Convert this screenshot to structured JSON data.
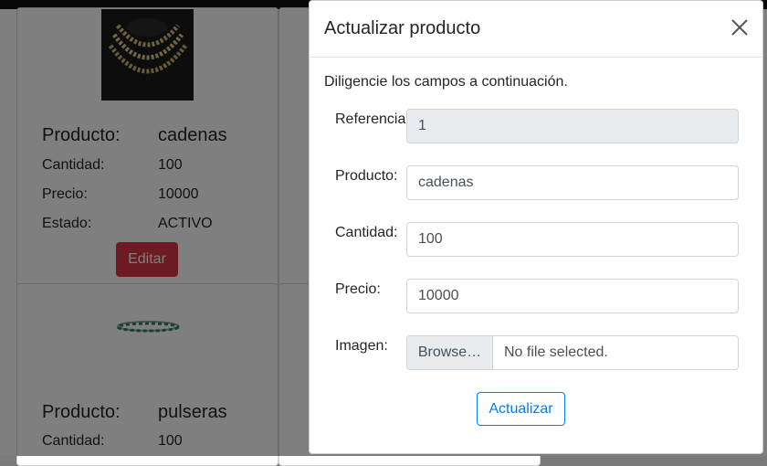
{
  "colors": {
    "danger": "#dc3545",
    "primary": "#007bff"
  },
  "products": [
    {
      "image_icon": "gold-chain-necklace-image",
      "product_label": "Producto:",
      "product_value": "cadenas",
      "qty_label": "Cantidad:",
      "qty_value": "100",
      "price_label": "Precio:",
      "price_value": "10000",
      "status_label": "Estado:",
      "status_value": "ACTIVO",
      "edit_label": "Editar"
    },
    {
      "image_icon": "bracelet-image",
      "product_label": "Producto:",
      "product_value": "pulseras",
      "qty_label": "Cantidad:",
      "qty_value": "100"
    }
  ],
  "modal": {
    "title": "Actualizar producto",
    "close_icon": "close-icon",
    "instructions": "Diligencie los campos a continuación.",
    "fields": {
      "referencia": {
        "label": "Referencia",
        "value": "1"
      },
      "producto": {
        "label": "Producto:",
        "value": "cadenas"
      },
      "cantidad": {
        "label": "Cantidad:",
        "value": "100"
      },
      "precio": {
        "label": "Precio:",
        "value": "10000"
      },
      "imagen": {
        "label": "Imagen:",
        "browse_label": "Browse…",
        "file_text": "No file selected."
      }
    },
    "submit_label": "Actualizar"
  }
}
